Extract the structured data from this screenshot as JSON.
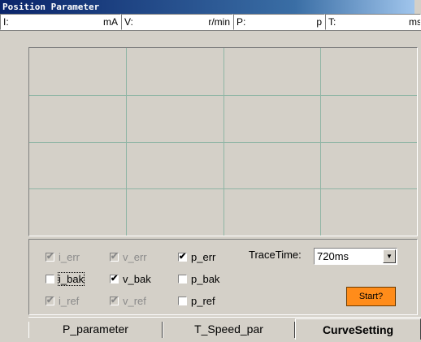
{
  "window": {
    "title": "Position Parameter"
  },
  "readouts": [
    {
      "label": "I:",
      "unit": "mA"
    },
    {
      "label": "V:",
      "unit": "r/min"
    },
    {
      "label": "P:",
      "unit": "p"
    },
    {
      "label": "T:",
      "unit": "ms"
    }
  ],
  "checkboxes": {
    "i_err": {
      "label": "i_err",
      "checked": true,
      "enabled": false
    },
    "v_err": {
      "label": "v_err",
      "checked": true,
      "enabled": false
    },
    "p_err": {
      "label": "p_err",
      "checked": true,
      "enabled": true
    },
    "i_bak": {
      "label": "i_bak",
      "checked": false,
      "enabled": true
    },
    "v_bak": {
      "label": "v_bak",
      "checked": true,
      "enabled": true
    },
    "p_bak": {
      "label": "p_bak",
      "checked": false,
      "enabled": true
    },
    "i_ref": {
      "label": "i_ref",
      "checked": true,
      "enabled": false
    },
    "v_ref": {
      "label": "v_ref",
      "checked": true,
      "enabled": false
    },
    "p_ref": {
      "label": "p_ref",
      "checked": false,
      "enabled": true
    }
  },
  "trace": {
    "label": "TraceTime:",
    "value": "720ms"
  },
  "start_button": {
    "label": "Start?",
    "color": "#ff8c1a"
  },
  "tabs": [
    {
      "label": "P_parameter",
      "active": false
    },
    {
      "label": "T_Speed_par",
      "active": false
    },
    {
      "label": "CurveSetting",
      "active": true
    }
  ],
  "plot": {
    "grid_color": "#8fb5a5",
    "background": "#d4d0c8",
    "columns": 4,
    "rows": 4
  }
}
